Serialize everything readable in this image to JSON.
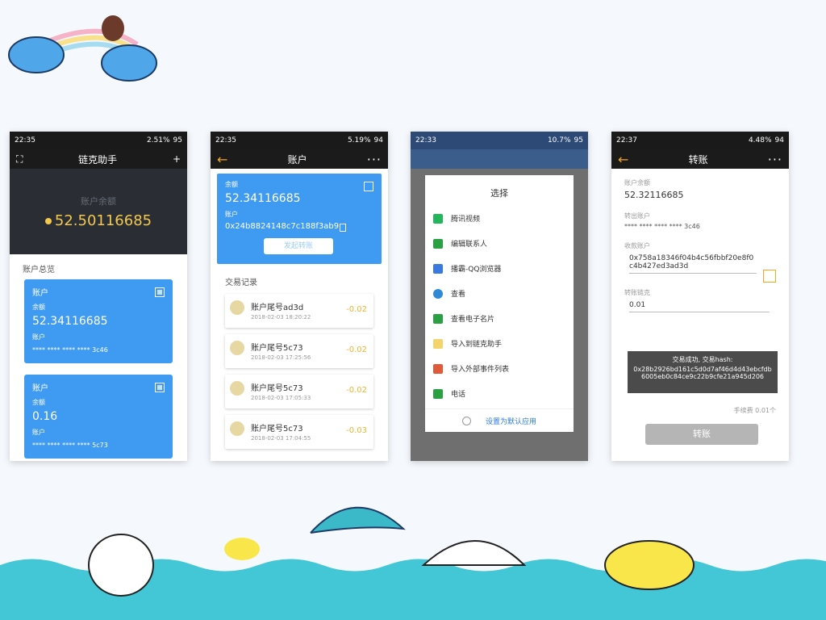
{
  "phones": [
    {
      "status": {
        "time": "22:35",
        "speed": "2.51%",
        "battery": "95"
      },
      "app_title": "链克助手",
      "hero": {
        "label": "账户余额",
        "value": "52.50116685"
      },
      "section": "账户总览",
      "cards": [
        {
          "title": "账户",
          "sub": "余额",
          "balance": "52.34116685",
          "num_label": "账户",
          "masked": "**** **** **** **** 3c46"
        },
        {
          "title": "账户",
          "sub": "余额",
          "balance": "0.16",
          "num_label": "账户",
          "masked": "**** **** **** **** 5c73"
        }
      ]
    },
    {
      "status": {
        "time": "22:35",
        "speed": "5.19%",
        "battery": "94"
      },
      "title": "账户",
      "balance_label": "余额",
      "balance": "52.34116685",
      "addr_label": "账户",
      "address": "0x24b8824148c7c188f3ab9",
      "transfer": "发起转账",
      "tx_title": "交易记录",
      "transactions": [
        {
          "name": "账户尾号ad3d",
          "time": "2018-02-03 18:20:22",
          "amount": "-0.02"
        },
        {
          "name": "账户尾号5c73",
          "time": "2018-02-03 17:25:56",
          "amount": "-0.02"
        },
        {
          "name": "账户尾号5c73",
          "time": "2018-02-03 17:05:33",
          "amount": "-0.02"
        },
        {
          "name": "账户尾号5c73",
          "time": "2018-02-03 17:04:55",
          "amount": "-0.03"
        }
      ]
    },
    {
      "status": {
        "time": "22:33",
        "speed": "10.7%",
        "battery": "95"
      },
      "title": "选择",
      "options": [
        {
          "label": "腾讯视频",
          "color": "#24b65a"
        },
        {
          "label": "编辑联系人",
          "color": "#2aa043"
        },
        {
          "label": "播霸-QQ浏览器",
          "color": "#3a79e0"
        },
        {
          "label": "查看",
          "color": "#2f8ad6"
        },
        {
          "label": "查看电子名片",
          "color": "#2aa043"
        },
        {
          "label": "导入到链克助手",
          "color": "#f3d36b"
        },
        {
          "label": "导入外部事件列表",
          "color": "#e05a3a"
        },
        {
          "label": "电话",
          "color": "#2aa043"
        }
      ],
      "default": "设置为默认应用"
    },
    {
      "status": {
        "time": "22:37",
        "speed": "4.48%",
        "battery": "94"
      },
      "title": "转账",
      "balance_label": "账户余额",
      "balance": "52.32116685",
      "from_label": "转出账户",
      "from": "**** **** **** **** 3c46",
      "to_label": "收款账户",
      "to": "0x758a18346f04b4c56fbbf20e8f0c4b427ed3ad3d",
      "amount_label": "转账链克",
      "amount": "0.01",
      "toast_title": "交易成功, 交易hash:",
      "toast_hash": "0x28b2926bd161c5d0d7af46d4d43ebcfdb6005eb0c84ce9c22b9cfe21a945d206",
      "fee": "手续费 0.01个",
      "submit": "转账"
    }
  ]
}
